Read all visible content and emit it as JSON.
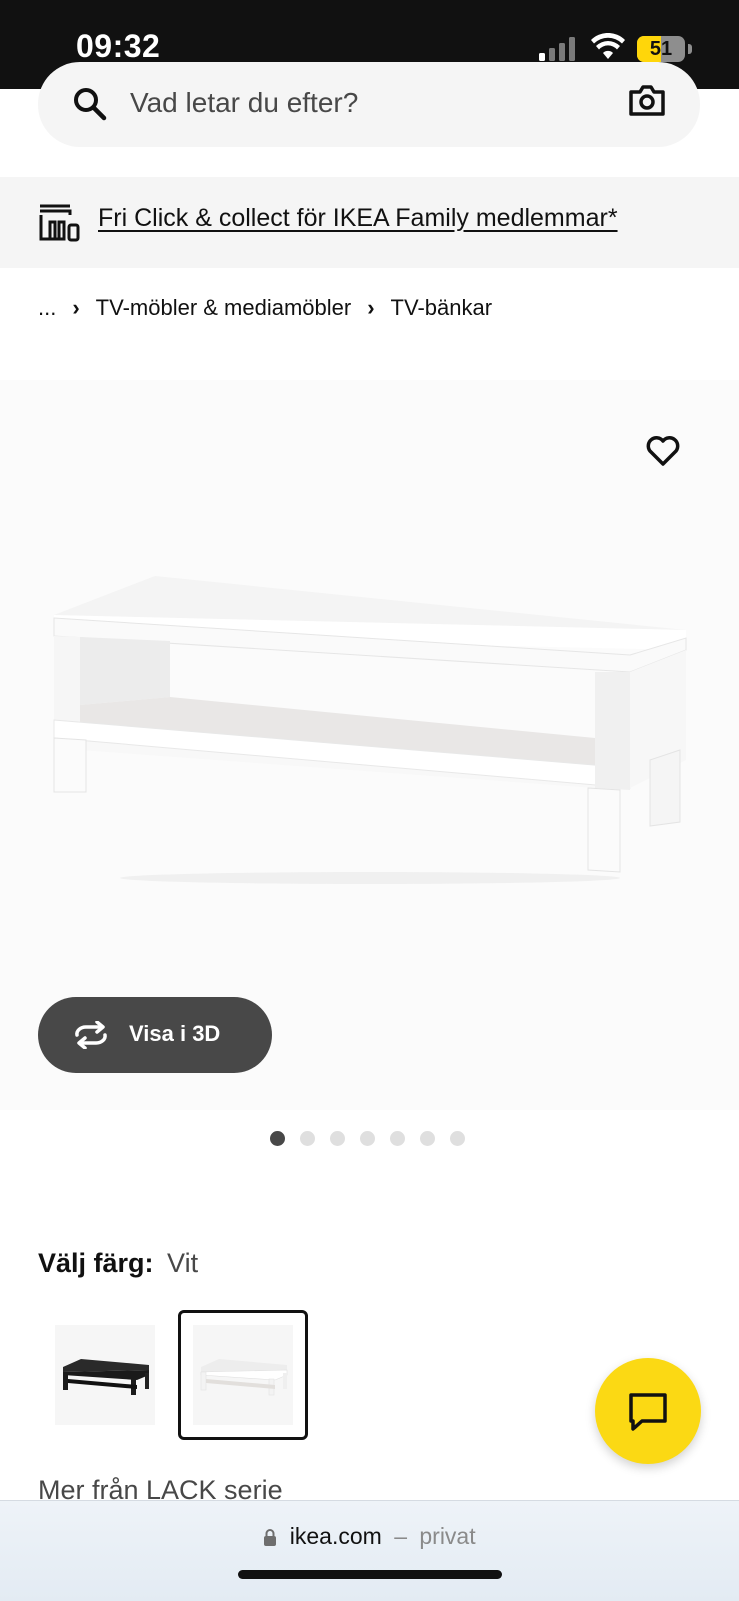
{
  "status_bar": {
    "time": "09:32",
    "battery_level": "51",
    "battery_fraction": 0.51,
    "icons": [
      "signal-icon",
      "wifi-icon",
      "battery-icon"
    ]
  },
  "search": {
    "placeholder": "Vad letar du efter?",
    "icons": [
      "search-icon",
      "camera-icon"
    ]
  },
  "promo": {
    "text": "Fri Click & collect för IKEA Family medlemmar*",
    "icon": "store-pickup-icon"
  },
  "breadcrumb": {
    "items": [
      "...",
      "TV-möbler & mediamöbler",
      "TV-bänkar"
    ],
    "separator": "›"
  },
  "gallery": {
    "view_3d_label": "Visa i 3D",
    "image_count": 7,
    "active_index": 0,
    "icons": [
      "heart-icon",
      "rotate-3d-icon"
    ]
  },
  "color_select": {
    "label": "Välj färg:",
    "value": "Vit",
    "options": [
      "black",
      "white"
    ],
    "selected": "white"
  },
  "more_from": "Mer från LACK serie",
  "url_bar": {
    "domain": "ikea.com",
    "separator": "–",
    "mode": "privat"
  },
  "colors": {
    "accent_yellow": "#fbd914",
    "dark_button": "#484848",
    "status_bar_bg": "#111111",
    "battery_yellow": "#ffd60a"
  }
}
